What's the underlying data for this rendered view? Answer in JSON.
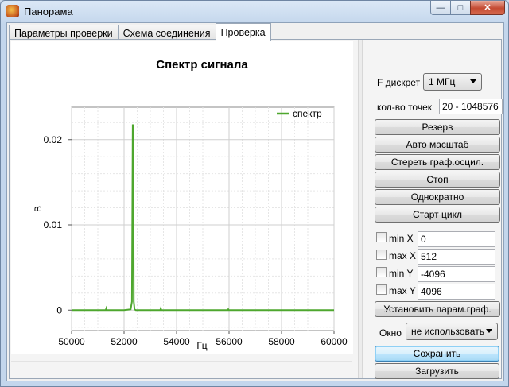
{
  "window": {
    "title": "Панорама",
    "min_glyph": "—",
    "max_glyph": "□",
    "close_glyph": "✕"
  },
  "tabs": [
    {
      "label": "Параметры проверки"
    },
    {
      "label": "Схема соединения"
    },
    {
      "label": "Проверка",
      "active": true
    }
  ],
  "controls": {
    "f_label": "F дискрет",
    "f_value": "1 МГц",
    "points_label": "кол-во точек",
    "points_value": "20 - 1048576",
    "buttons": [
      "Резерв",
      "Авто масштаб",
      "Стереть граф.осцил.",
      "Стоп",
      "Однократно",
      "Старт цикл"
    ],
    "ranges": [
      {
        "label": "min X",
        "value": "0"
      },
      {
        "label": "max X",
        "value": "512"
      },
      {
        "label": "min Y",
        "value": "-4096"
      },
      {
        "label": "max Y",
        "value": "4096"
      }
    ],
    "apply_button": "Установить парам.граф.",
    "window_label": "Окно",
    "window_value": "не использовать",
    "save_button": "Сохранить",
    "load_button": "Загрузить"
  },
  "chart_data": {
    "type": "line",
    "title": "Спектр сигнала",
    "xlabel": "Гц",
    "ylabel": "В",
    "xlim": [
      50000,
      60000
    ],
    "ylim": [
      -0.0024,
      0.0238
    ],
    "xticks": [
      50000,
      52000,
      54000,
      56000,
      58000,
      60000
    ],
    "yticks": [
      0,
      0.01,
      0.02
    ],
    "ytick_labels": [
      "0",
      "0.01",
      "0.02"
    ],
    "grid": true,
    "legend_position": "top-right",
    "series": [
      {
        "name": "спектр",
        "color": "#4ea72e",
        "x": [
          50000,
          51000,
          51300,
          51320,
          51340,
          52000,
          52250,
          52300,
          52330,
          52350,
          52370,
          52400,
          52450,
          53000,
          53380,
          53400,
          53420,
          54000,
          55000,
          55950,
          55970,
          55990,
          56500,
          57000,
          58000,
          59000,
          60000
        ],
        "y": [
          0,
          0,
          0,
          0.0002,
          0,
          0,
          0.0001,
          0.001,
          0.0217,
          0.0217,
          0.001,
          0.0001,
          0,
          0,
          0,
          0.0002,
          0,
          0,
          0,
          0,
          0.0001,
          0,
          0,
          0,
          0,
          0,
          0
        ]
      }
    ]
  }
}
